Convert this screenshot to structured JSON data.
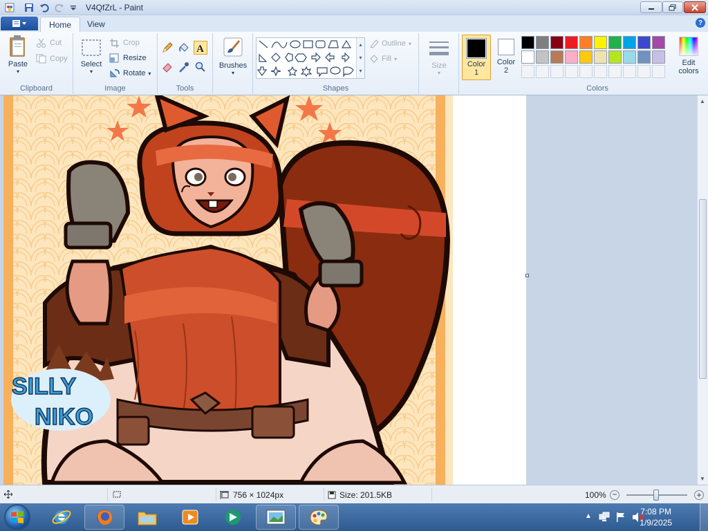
{
  "window": {
    "title": "V4QfZrL - Paint"
  },
  "tabs": [
    {
      "label": "Home"
    },
    {
      "label": "View"
    }
  ],
  "ribbon": {
    "clipboard": {
      "label": "Clipboard",
      "paste": "Paste",
      "cut": "Cut",
      "copy": "Copy"
    },
    "image": {
      "label": "Image",
      "select": "Select",
      "crop": "Crop",
      "resize": "Resize",
      "rotate": "Rotate"
    },
    "tools": {
      "label": "Tools"
    },
    "brushes": {
      "label": "Brushes"
    },
    "shapes": {
      "label": "Shapes",
      "outline": "Outline",
      "fill": "Fill"
    },
    "size": {
      "label": "Size"
    },
    "color1": {
      "label": "Color",
      "num": "1",
      "color": "#000000"
    },
    "color2": {
      "label": "Color",
      "num": "2",
      "color": "#ffffff"
    },
    "colors": {
      "label": "Colors",
      "edit": "Edit",
      "edit2": "colors"
    },
    "palette_row1": [
      "#000000",
      "#7f7f7f",
      "#880015",
      "#ed1c24",
      "#ff7f27",
      "#fff200",
      "#22b14c",
      "#00a2e8",
      "#3f48cc",
      "#a349a4"
    ],
    "palette_row2": [
      "#ffffff",
      "#c3c3c3",
      "#b97a57",
      "#ffaec9",
      "#ffc90e",
      "#efe4b0",
      "#b5e61d",
      "#99d9ea",
      "#7092be",
      "#c8bfe7"
    ]
  },
  "artwork": {
    "logo_line1": "SILLY",
    "logo_line2": "NIKO"
  },
  "status": {
    "dimensions": "756 × 1024px",
    "size": "Size: 201.5KB",
    "zoom": "100%"
  },
  "taskbar": {
    "time": "7:08 PM",
    "date": "1/9/2025"
  },
  "colors": {
    "accent": "#2d5a90",
    "ribbon": "#f5f8fc"
  }
}
